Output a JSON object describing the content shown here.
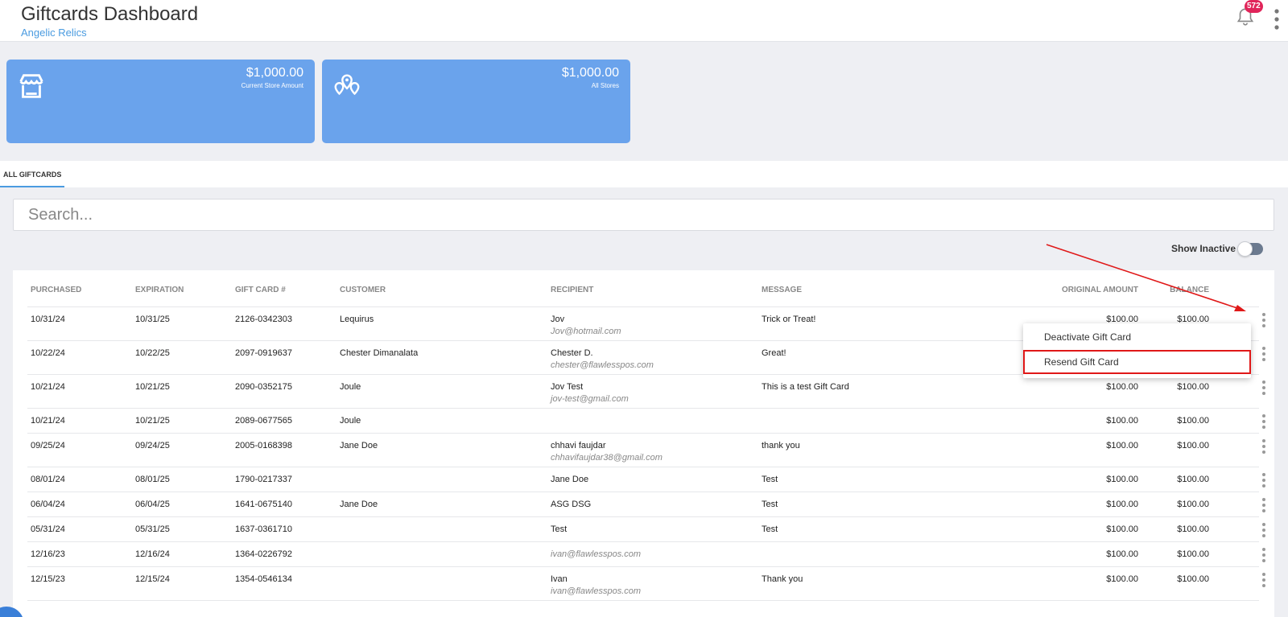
{
  "header": {
    "title": "Giftcards Dashboard",
    "subtitle": "Angelic Relics",
    "notification_count": "572"
  },
  "cards": [
    {
      "amount": "$1,000.00",
      "label": "Current Store Amount",
      "icon": "store-icon"
    },
    {
      "amount": "$1,000.00",
      "label": "All Stores",
      "icon": "map-pins-icon"
    }
  ],
  "tabs": [
    {
      "label": "ALL GIFTCARDS",
      "active": true
    }
  ],
  "search": {
    "placeholder": "Search...",
    "value": ""
  },
  "show_inactive": {
    "label": "Show Inactive",
    "on": false
  },
  "table": {
    "columns": [
      "PURCHASED",
      "EXPIRATION",
      "GIFT CARD #",
      "CUSTOMER",
      "RECIPIENT",
      "MESSAGE",
      "ORIGINAL AMOUNT",
      "BALANCE"
    ],
    "rows": [
      {
        "purchased": "10/31/24",
        "expiration": "10/31/25",
        "card": "2126-0342303",
        "customer": "Lequirus",
        "recipient": "Jov",
        "email": "Jov@hotmail.com",
        "message": "Trick or Treat!",
        "original": "$100.00",
        "balance": "$100.00"
      },
      {
        "purchased": "10/22/24",
        "expiration": "10/22/25",
        "card": "2097-0919637",
        "customer": "Chester Dimanalata",
        "recipient": "Chester D.",
        "email": "chester@flawlesspos.com",
        "message": "Great!",
        "original": "",
        "balance": ""
      },
      {
        "purchased": "10/21/24",
        "expiration": "10/21/25",
        "card": "2090-0352175",
        "customer": "Joule",
        "recipient": "Jov Test",
        "email": "jov-test@gmail.com",
        "message": "This is a test Gift Card",
        "original": "$100.00",
        "balance": "$100.00"
      },
      {
        "purchased": "10/21/24",
        "expiration": "10/21/25",
        "card": "2089-0677565",
        "customer": "Joule",
        "recipient": "",
        "email": "",
        "message": "",
        "original": "$100.00",
        "balance": "$100.00"
      },
      {
        "purchased": "09/25/24",
        "expiration": "09/24/25",
        "card": "2005-0168398",
        "customer": "Jane Doe",
        "recipient": "chhavi faujdar",
        "email": "chhavifaujdar38@gmail.com",
        "message": "thank you",
        "original": "$100.00",
        "balance": "$100.00"
      },
      {
        "purchased": "08/01/24",
        "expiration": "08/01/25",
        "card": "1790-0217337",
        "customer": "",
        "recipient": "Jane Doe",
        "email": "",
        "message": "Test",
        "original": "$100.00",
        "balance": "$100.00"
      },
      {
        "purchased": "06/04/24",
        "expiration": "06/04/25",
        "card": "1641-0675140",
        "customer": "Jane Doe",
        "recipient": "ASG DSG",
        "email": "",
        "message": "Test",
        "original": "$100.00",
        "balance": "$100.00"
      },
      {
        "purchased": "05/31/24",
        "expiration": "05/31/25",
        "card": "1637-0361710",
        "customer": "",
        "recipient": "Test",
        "email": "",
        "message": "Test",
        "original": "$100.00",
        "balance": "$100.00"
      },
      {
        "purchased": "12/16/23",
        "expiration": "12/16/24",
        "card": "1364-0226792",
        "customer": "",
        "recipient": "",
        "email": "ivan@flawlesspos.com",
        "message": "",
        "original": "$100.00",
        "balance": "$100.00"
      },
      {
        "purchased": "12/15/23",
        "expiration": "12/15/24",
        "card": "1354-0546134",
        "customer": "",
        "recipient": "Ivan",
        "email": "ivan@flawlesspos.com",
        "message": "Thank you",
        "original": "$100.00",
        "balance": "$100.00"
      }
    ]
  },
  "row_menu": {
    "items": [
      "Deactivate Gift Card",
      "Resend Gift Card"
    ],
    "highlighted_index": 1
  },
  "colors": {
    "card_bg": "#6aa3ec",
    "accent": "#4a9be0",
    "badge": "#e0255a",
    "annotation": "#e01818"
  }
}
